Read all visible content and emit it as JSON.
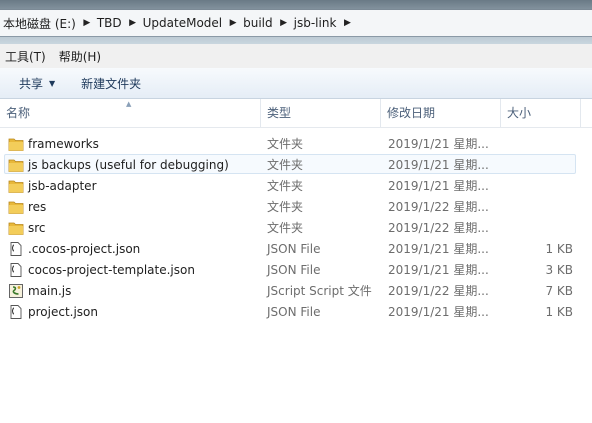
{
  "address": {
    "crumbs": [
      "本地磁盘 (E:)",
      "TBD",
      "UpdateModel",
      "build",
      "jsb-link"
    ]
  },
  "menu": {
    "items": [
      "工具(T)",
      "帮助(H)"
    ]
  },
  "toolbar": {
    "share_label": "共享",
    "new_folder_label": "新建文件夹"
  },
  "columns": {
    "name": "名称",
    "type": "类型",
    "date": "修改日期",
    "size": "大小"
  },
  "files": [
    {
      "name": "frameworks",
      "type": "文件夹",
      "date": "2019/1/21 星期...",
      "size": "",
      "icon": "folder-icon"
    },
    {
      "name": "js backups (useful for debugging)",
      "type": "文件夹",
      "date": "2019/1/21 星期...",
      "size": "",
      "icon": "folder-icon"
    },
    {
      "name": "jsb-adapter",
      "type": "文件夹",
      "date": "2019/1/21 星期...",
      "size": "",
      "icon": "folder-icon"
    },
    {
      "name": "res",
      "type": "文件夹",
      "date": "2019/1/22 星期...",
      "size": "",
      "icon": "folder-icon"
    },
    {
      "name": "src",
      "type": "文件夹",
      "date": "2019/1/22 星期...",
      "size": "",
      "icon": "folder-icon"
    },
    {
      "name": ".cocos-project.json",
      "type": "JSON File",
      "date": "2019/1/21 星期...",
      "size": "1 KB",
      "icon": "json-file-icon"
    },
    {
      "name": "cocos-project-template.json",
      "type": "JSON File",
      "date": "2019/1/21 星期...",
      "size": "3 KB",
      "icon": "json-file-icon"
    },
    {
      "name": "main.js",
      "type": "JScript Script 文件",
      "date": "2019/1/22 星期...",
      "size": "7 KB",
      "icon": "jscript-file-icon"
    },
    {
      "name": "project.json",
      "type": "JSON File",
      "date": "2019/1/21 星期...",
      "size": "1 KB",
      "icon": "json-file-icon"
    }
  ],
  "colors": {
    "folder": "#e8b83a",
    "header_text": "#4c607a",
    "toolbar_text": "#1e395b",
    "hover_border": "#d5e4f2"
  }
}
